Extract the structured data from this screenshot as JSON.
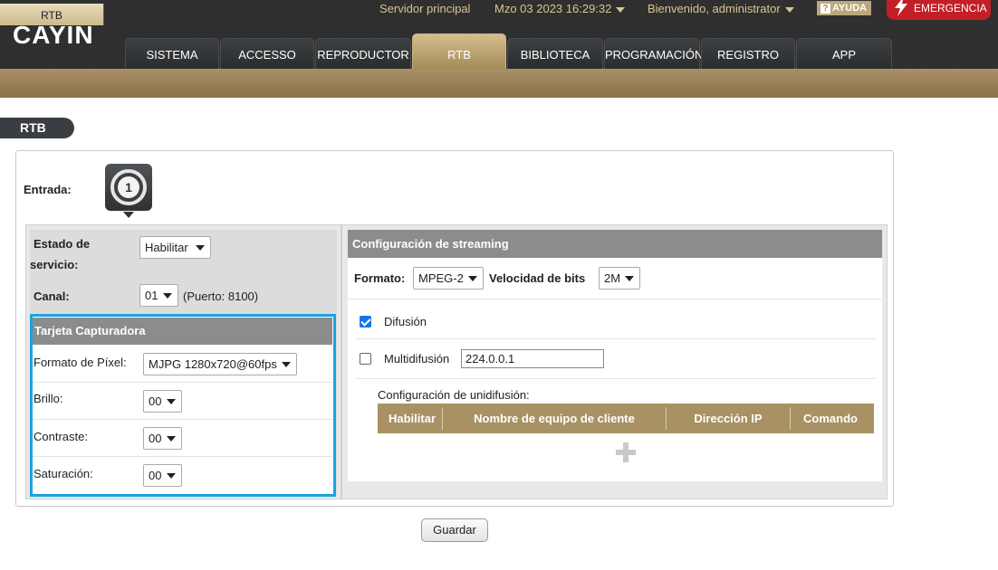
{
  "header": {
    "logo_text": "CAYIN",
    "server": "Servidor principal",
    "datetime": "Mzo 03 2023 16:29:32",
    "welcome": "Bienvenido, administrator",
    "help": "AYUDA",
    "emergency": "EMERGENCIA"
  },
  "tabs": [
    {
      "label": "SISTEMA"
    },
    {
      "label": "ACCESSO"
    },
    {
      "label": "REPRODUCTOR"
    },
    {
      "label": "RTB",
      "active": true
    },
    {
      "label": "BIBLIOTECA"
    },
    {
      "label": "PROGRAMACIÓN"
    },
    {
      "label": "REGISTRO"
    },
    {
      "label": "APP"
    }
  ],
  "subtab": "RTB",
  "page_title": "RTB",
  "entrada": {
    "label": "Entrada:",
    "input_number": "1"
  },
  "service": {
    "estado_label_1": "Estado de",
    "estado_label_2": "servicio:",
    "estado_value": "Habilitar",
    "canal_label": "Canal:",
    "canal_value": "01",
    "puerto_note": "(Puerto: 8100)"
  },
  "capture_card": {
    "title": "Tarjeta Capturadora",
    "pixel_format_label": "Formato de Píxel:",
    "pixel_format_value": "MJPG 1280x720@60fps",
    "brillo_label": "Brillo:",
    "brillo_value": "00",
    "contraste_label": "Contraste:",
    "contraste_value": "00",
    "saturacion_label": "Saturación:",
    "saturacion_value": "00"
  },
  "streaming": {
    "title": "Configuración de streaming",
    "formato_label": "Formato:",
    "formato_value": "MPEG-2",
    "bitrate_label": "Velocidad de bits",
    "bitrate_value": "2M",
    "broadcast_label": "Difusión",
    "broadcast_checked": true,
    "multicast_label": "Multidifusión",
    "multicast_checked": false,
    "multicast_ip": "224.0.0.1",
    "unicast_label": "Configuración de unidifusión:",
    "unicast_columns": [
      "Habilitar",
      "Nombre de equipo de cliente",
      "Dirección IP",
      "Comando"
    ]
  },
  "save_label": "Guardar",
  "colors": {
    "accent_gold": "#a89264",
    "highlight_blue": "#1aa3e0",
    "emergency_red": "#c21f26"
  }
}
